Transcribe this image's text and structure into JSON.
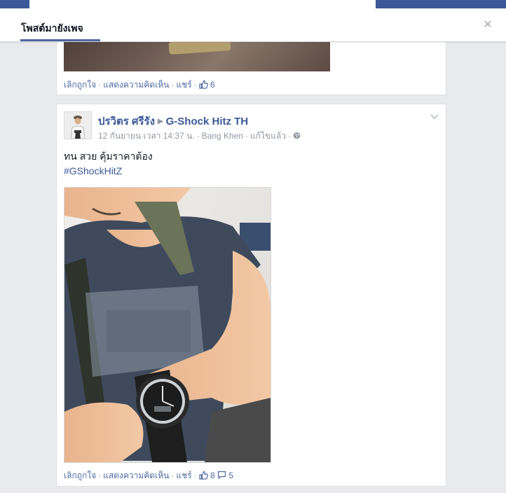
{
  "topbar": {
    "search_placeholder": "G-Shock Hitz TH",
    "page_name": "G-Shock Hitz TH"
  },
  "dialog": {
    "tab_label": "โพสต์มายังเพจ",
    "close_icon": "close-icon"
  },
  "posts": [
    {
      "actions": {
        "unlike": "เลิกถูกใจ",
        "comment": "แสดงความคิดเห็น",
        "share": "แชร์",
        "likes": "6"
      }
    },
    {
      "author": "ปรวิตร ศรีรัง",
      "target_page": "G-Shock Hitz TH",
      "timestamp": "12 กันยายน เวลา 14:37 น.",
      "location": "Bang Khen",
      "edited": "แก้ไขแล้ว",
      "privacy_icon": "globe-icon",
      "text": "ทน สวย คุ้มราคาต้อง",
      "hashtag": "#GShockHitZ",
      "actions": {
        "unlike": "เลิกถูกใจ",
        "comment": "แสดงความคิดเห็น",
        "share": "แชร์",
        "likes": "8",
        "comments": "5"
      }
    }
  ],
  "colors": {
    "brand": "#3b5998",
    "link": "#4e69a2",
    "meta": "#9197a3",
    "background": "#e9eaed"
  }
}
